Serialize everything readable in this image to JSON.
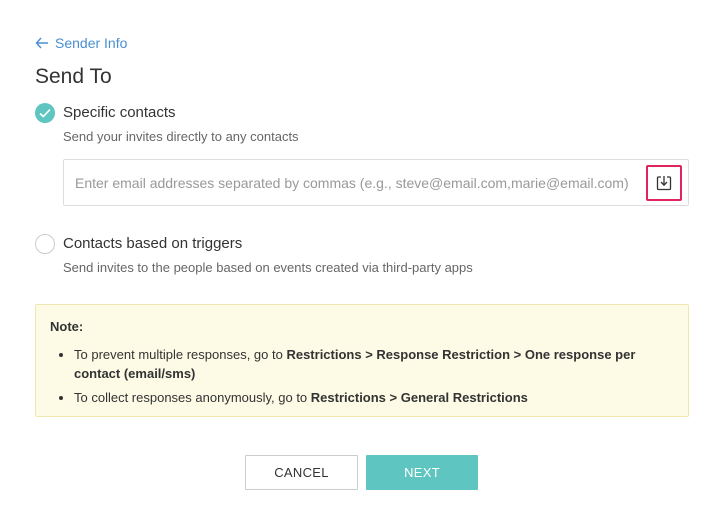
{
  "nav": {
    "back_label": "Sender Info"
  },
  "page": {
    "title": "Send To"
  },
  "options": [
    {
      "title": "Specific contacts",
      "desc": "Send your invites directly to any contacts",
      "checked": true
    },
    {
      "title": "Contacts based on triggers",
      "desc": "Send invites to the people based on events created via third-party apps",
      "checked": false
    }
  ],
  "email_input": {
    "value": "",
    "placeholder": "Enter email addresses separated by commas (e.g., steve@email.com,marie@email.com)",
    "import_icon": "import-icon"
  },
  "note": {
    "title": "Note:",
    "items": [
      {
        "prefix": "To prevent multiple responses, go to ",
        "path": "Restrictions > Response Restriction > One response per contact (email/sms)"
      },
      {
        "prefix": "To collect responses anonymously, go to ",
        "path": "Restrictions > General Restrictions"
      }
    ]
  },
  "buttons": {
    "cancel": "CANCEL",
    "next": "NEXT"
  },
  "colors": {
    "accent": "#5ec5c0",
    "link": "#4a8fd1",
    "highlight": "#e0245e",
    "note_bg": "#fdfbe6"
  }
}
